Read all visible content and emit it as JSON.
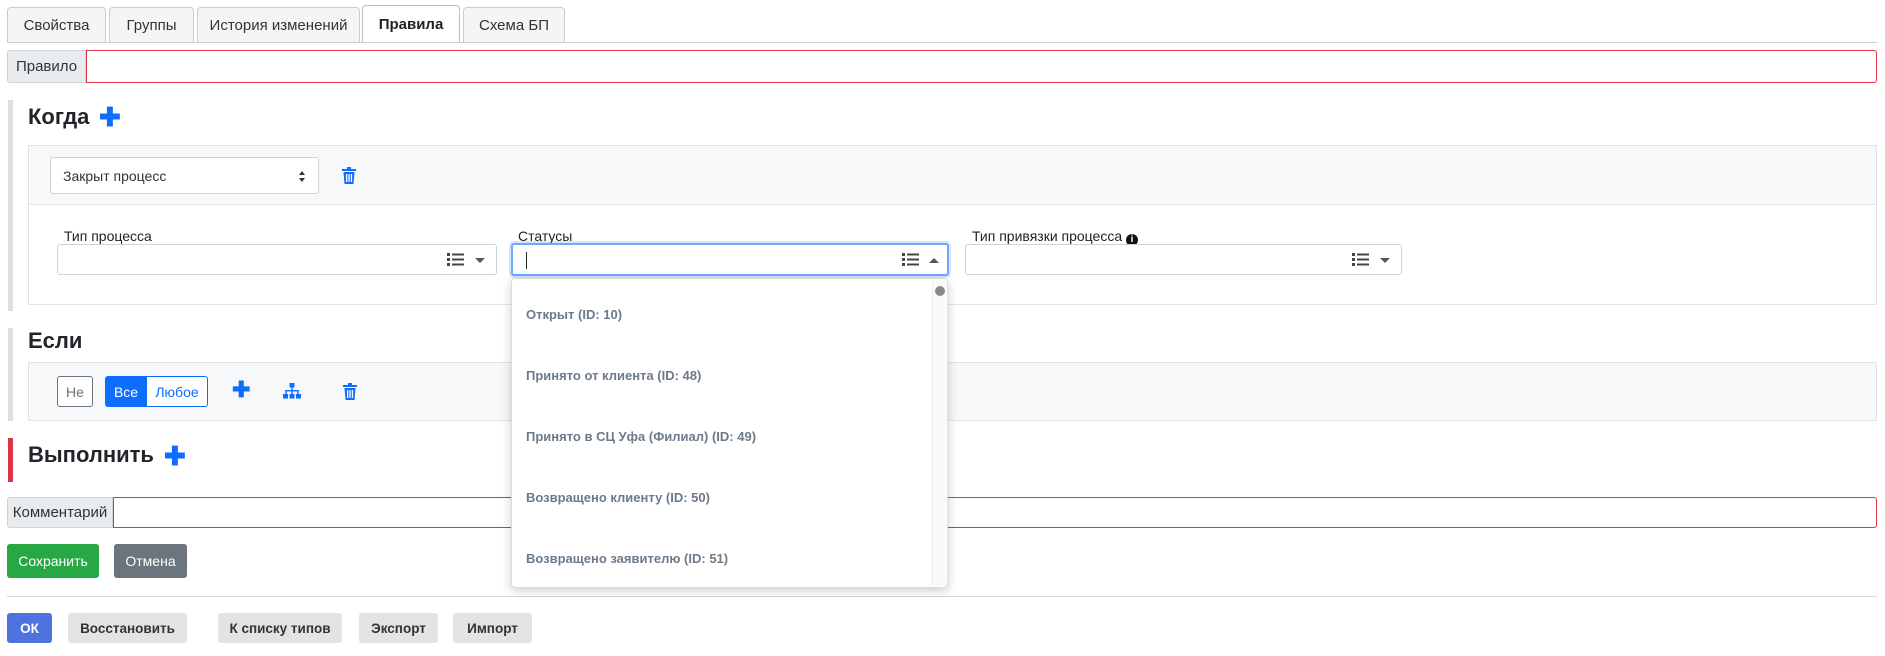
{
  "tabs": [
    {
      "label": "Свойства"
    },
    {
      "label": "Группы"
    },
    {
      "label": "История изменений"
    },
    {
      "label": "Правила"
    },
    {
      "label": "Схема БП"
    }
  ],
  "rule": {
    "label": "Правило",
    "value": ""
  },
  "when": {
    "title": "Когда",
    "event_select": "Закрыт процесс",
    "fields": {
      "process_type": "Тип процесса",
      "statuses": "Статусы",
      "binding_type": "Тип привязки процесса"
    }
  },
  "statuses_dropdown": [
    "Открыт (ID: 10)",
    "Принято от клиента (ID: 48)",
    "Принято в СЦ Уфа (Филиал) (ID: 49)",
    "Возвращено клиенту (ID: 50)",
    "Возвращено заявителю (ID: 51)"
  ],
  "if": {
    "title": "Если",
    "not_label": "Не",
    "all_label": "Все",
    "any_label": "Любое"
  },
  "do": {
    "title": "Выполнить"
  },
  "comment": {
    "label": "Комментарий",
    "value": ""
  },
  "form_buttons": {
    "save": "Сохранить",
    "cancel": "Отмена"
  },
  "footer_buttons": {
    "ok": "ОК",
    "restore": "Восстановить",
    "to_types": "К списку типов",
    "export": "Экспорт",
    "import": "Импорт"
  },
  "colors": {
    "primary": "#0d6efd",
    "danger": "#dc3545",
    "success": "#28a745",
    "secondary": "#6c757d",
    "ok": "#4e73df"
  }
}
